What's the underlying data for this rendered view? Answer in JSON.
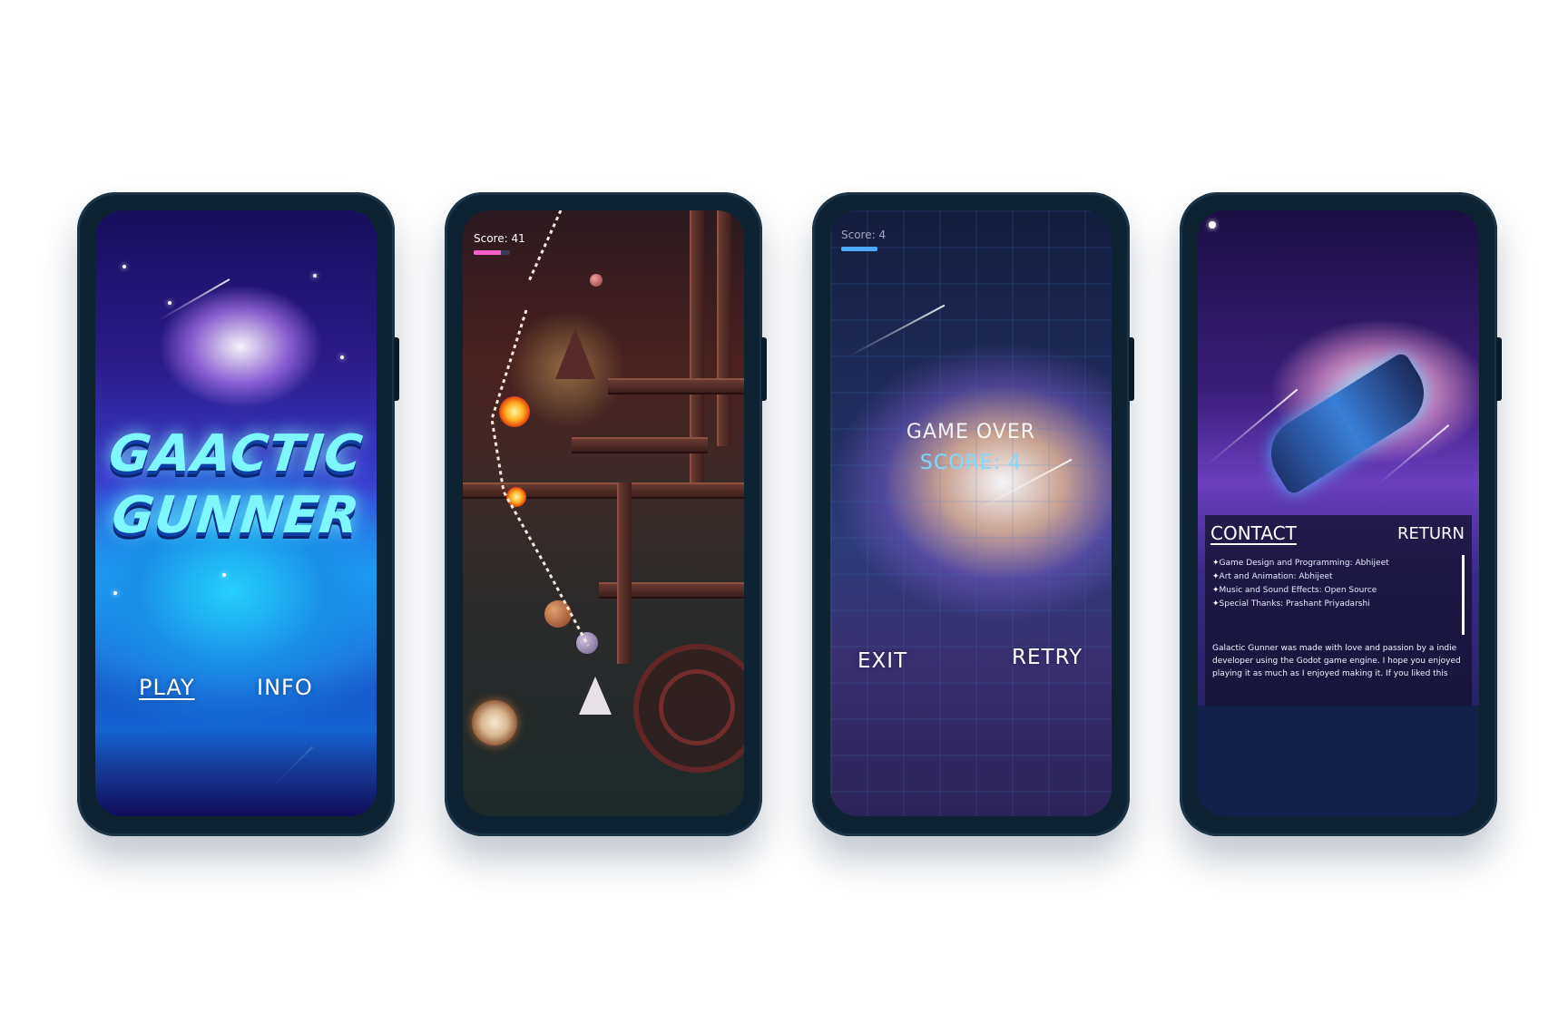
{
  "screens": {
    "title_screen": {
      "logo_line1": "GAACTIC",
      "logo_line2": "GUNNER",
      "play_label": "PLAY",
      "info_label": "INFO"
    },
    "gameplay_screen": {
      "score_text": "Score: 41",
      "health_level": 0.75
    },
    "game_over_screen": {
      "score_hud": "Score: 4",
      "title": "GAME OVER",
      "score_text": "SCORE: 4",
      "exit_label": "EXIT",
      "retry_label": "RETRY"
    },
    "info_screen": {
      "contact_label": "CONTACT",
      "return_label": "RETURN",
      "credits": [
        "Game Design and Programming: Abhijeet",
        "Art and Animation: Abhijeet",
        "Music and Sound Effects: Open Source",
        "Special Thanks: Prashant Priyadarshi"
      ],
      "about": "Galactic Gunner was made with love and passion by a indie developer using the Godot game engine. I hope you enjoyed playing it as much as I enjoyed making it. If you liked this"
    }
  },
  "colors": {
    "phone_frame": "#0f2232",
    "logo_cyan": "#7ff7ff",
    "score_blue": "#7fd8ff",
    "health_pink": "#ff5fc8"
  }
}
